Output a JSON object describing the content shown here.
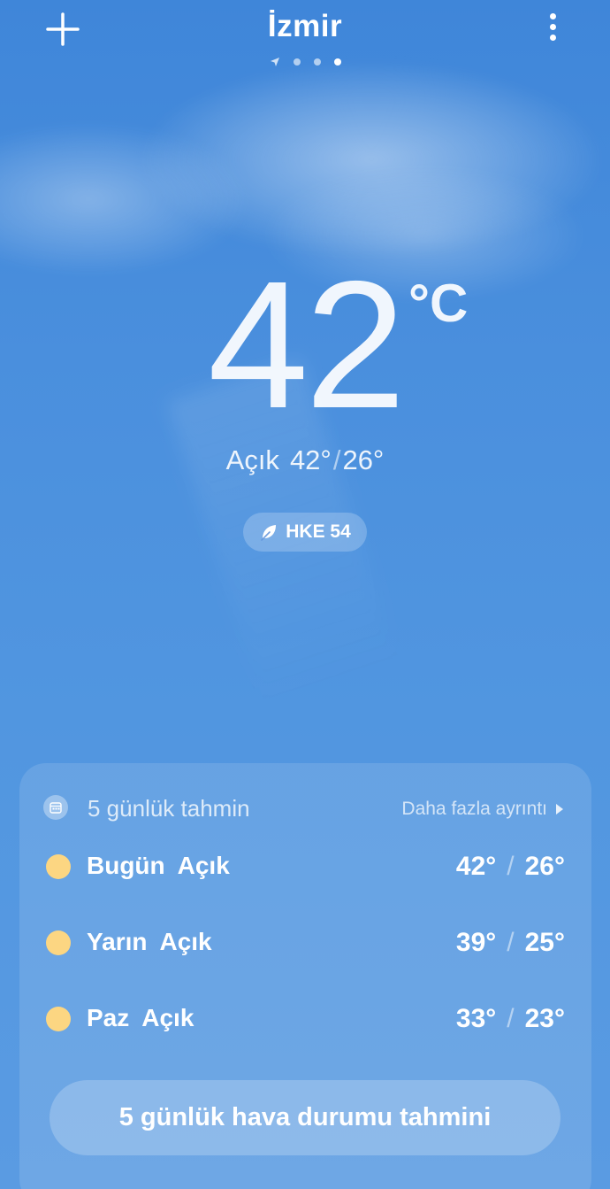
{
  "header": {
    "city": "İzmir",
    "add_icon": "plus-icon",
    "menu_icon": "more-vertical-icon",
    "pages": {
      "count": 4,
      "active_index": 3,
      "first_is_location": true
    }
  },
  "current": {
    "temperature": "42",
    "unit": "°C",
    "condition": "Açık",
    "high": "42°",
    "low": "26°",
    "aqi_label": "HKE 54",
    "aqi_icon": "leaf-icon"
  },
  "forecast": {
    "title": "5 günlük tahmin",
    "more_label": "Daha fazla ayrıntı",
    "days": [
      {
        "day": "Bugün",
        "desc": "Açık",
        "high": "42°",
        "low": "26°",
        "icon": "sun-icon"
      },
      {
        "day": "Yarın",
        "desc": "Açık",
        "high": "39°",
        "low": "25°",
        "icon": "sun-icon"
      },
      {
        "day": "Paz",
        "desc": "Açık",
        "high": "33°",
        "low": "23°",
        "icon": "sun-icon"
      }
    ],
    "button_label": "5 günlük hava durumu tahmini"
  },
  "colors": {
    "sky_top": "#3f86d9",
    "sky_bottom": "#5a9be2",
    "sun": "#fcd682"
  }
}
